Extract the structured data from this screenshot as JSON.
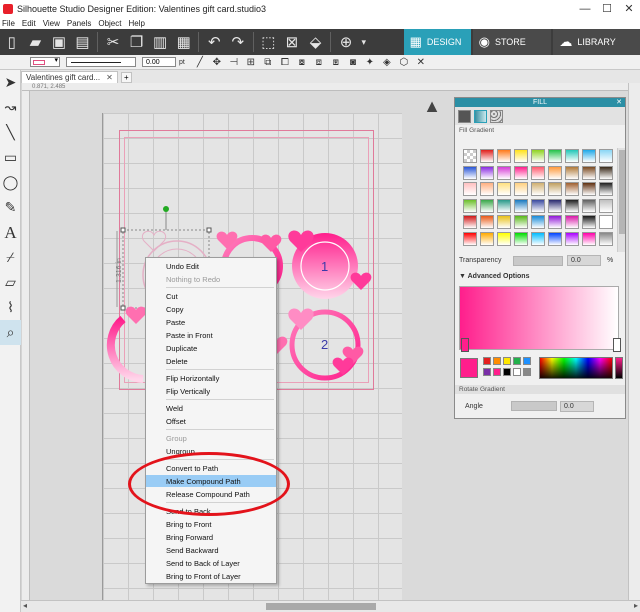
{
  "window": {
    "title": "Silhouette Studio Designer Edition: Valentines gift card.studio3"
  },
  "menu": [
    "File",
    "Edit",
    "View",
    "Panels",
    "Object",
    "Help"
  ],
  "tabs": {
    "design": "DESIGN",
    "store": "STORE",
    "library": "LIBRARY"
  },
  "toolbar2": {
    "line_width_value": "0.00",
    "line_width_unit": "pt"
  },
  "document": {
    "tab_label": "Valentines gift card...",
    "coords": "0.871, 2.485"
  },
  "selection": {
    "height_label": "1.316 in"
  },
  "canvas_labels": {
    "label_1": "1",
    "label_2": "2"
  },
  "context_menu": {
    "undo": "Undo Edit",
    "redo": "Nothing to Redo",
    "cut": "Cut",
    "copy": "Copy",
    "paste": "Paste",
    "paste_front": "Paste in Front",
    "duplicate": "Duplicate",
    "delete": "Delete",
    "flip_h": "Flip Horizontally",
    "flip_v": "Flip Vertically",
    "weld": "Weld",
    "offset": "Offset",
    "group": "Group",
    "ungroup": "Ungroup",
    "convert_path": "Convert to Path",
    "make_compound": "Make Compound Path",
    "release_compound": "Release Compound Path",
    "send_back": "Send to Back",
    "bring_front": "Bring to Front",
    "bring_forward": "Bring Forward",
    "send_backward": "Send Backward",
    "send_back_layer": "Send to Back of Layer",
    "bring_front_layer": "Bring to Front of Layer"
  },
  "fill_panel": {
    "title": "FILL",
    "subtitle": "Fill Gradient",
    "transparency_label": "Transparency",
    "transparency_value": "0.0",
    "transparency_unit": "%",
    "advanced_label": "Advanced Options",
    "rotate_label": "Rotate Gradient",
    "angle_label": "Angle",
    "angle_value": "0.0",
    "current_color": "#ff1e8c"
  },
  "colors": {
    "accent": "#2aa0b8",
    "brand_pink": "#ff1e8c",
    "highlight": "#99ccf5",
    "annotation_red": "#e3131b"
  }
}
